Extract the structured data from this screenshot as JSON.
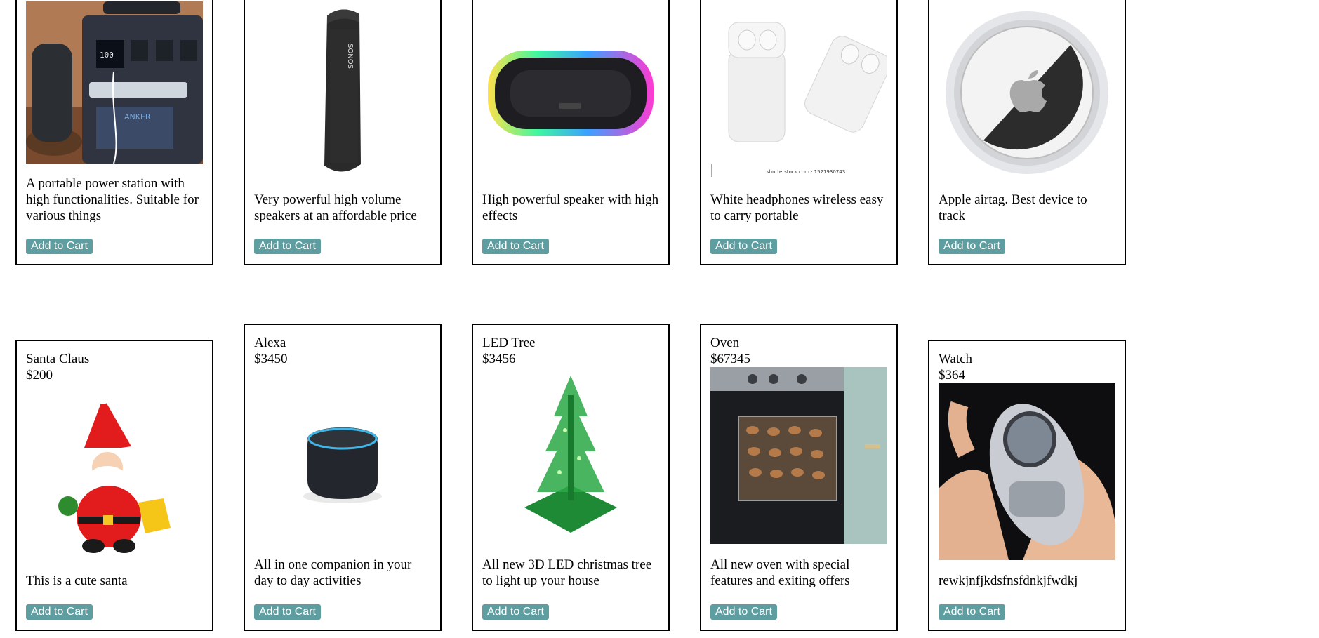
{
  "products_row1": [
    {
      "description": "A portable power station with high functionalities. Suitable for various things",
      "button_label": "Add to Cart",
      "image_icon": "power-station-image"
    },
    {
      "description": "Very powerful high volume speakers at an affordable price",
      "button_label": "Add to Cart",
      "image_icon": "speaker-image",
      "image_brand": "SONOS"
    },
    {
      "description": "High powerful speaker with high effects",
      "button_label": "Add to Cart",
      "image_icon": "rgb-speaker-image"
    },
    {
      "description": "White headphones wireless easy to carry portable",
      "button_label": "Add to Cart",
      "image_icon": "earbuds-image",
      "image_watermark": "shutterstock.com · 1521930743"
    },
    {
      "description": "Apple airtag. Best device to track",
      "button_label": "Add to Cart",
      "image_icon": "airtag-image"
    }
  ],
  "products_row2": [
    {
      "name": "Santa Claus",
      "price": "$200",
      "description": "This is a cute santa",
      "button_label": "Add to Cart",
      "image_icon": "santa-toy-image"
    },
    {
      "name": "Alexa",
      "price": "$3450",
      "description": "All in one companion in your day to day activities",
      "button_label": "Add to Cart",
      "image_icon": "smart-speaker-image"
    },
    {
      "name": "LED Tree",
      "price": "$3456",
      "description": "All new 3D LED christmas tree to light up your house",
      "button_label": "Add to Cart",
      "image_icon": "led-tree-image"
    },
    {
      "name": "Oven",
      "price": "$67345",
      "description": "All new oven with special features and exiting offers",
      "button_label": "Add to Cart",
      "image_icon": "oven-image"
    },
    {
      "name": "Watch",
      "price": "$364",
      "description": "rewkjnfjkdsfnsfdnkjfwdkj",
      "button_label": "Add to Cart",
      "image_icon": "watch-image"
    }
  ],
  "colors": {
    "button_bg": "#5f9ea0",
    "button_text": "#ffffff",
    "card_border": "#000000"
  }
}
